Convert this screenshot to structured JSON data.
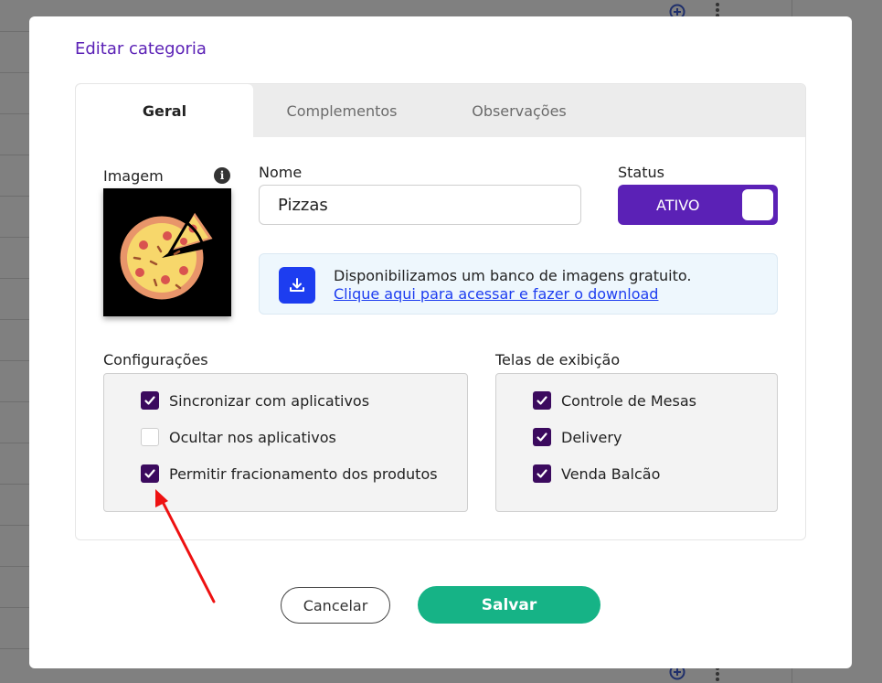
{
  "modal": {
    "title": "Editar categoria"
  },
  "tabs": [
    {
      "label": "Geral",
      "active": true
    },
    {
      "label": "Complementos",
      "active": false
    },
    {
      "label": "Observações",
      "active": false
    }
  ],
  "image": {
    "label": "Imagem",
    "info_icon": "info-icon",
    "picture": "pizza-icon"
  },
  "name": {
    "label": "Nome",
    "value": "Pizzas"
  },
  "status": {
    "label": "Status",
    "value": "ATIVO",
    "on": true
  },
  "banner": {
    "text": "Disponibilizamos um banco de imagens gratuito.",
    "link": "Clique aqui para acessar e fazer o download",
    "icon": "download-icon"
  },
  "configuracoes": {
    "label": "Configurações",
    "items": [
      {
        "label": "Sincronizar com aplicativos",
        "checked": true
      },
      {
        "label": "Ocultar nos aplicativos",
        "checked": false
      },
      {
        "label": "Permitir fracionamento dos produtos",
        "checked": true
      }
    ]
  },
  "telas": {
    "label": "Telas de exibição",
    "items": [
      {
        "label": "Controle de Mesas",
        "checked": true
      },
      {
        "label": "Delivery",
        "checked": true
      },
      {
        "label": "Venda Balcão",
        "checked": true
      }
    ]
  },
  "actions": {
    "cancel": "Cancelar",
    "save": "Salvar"
  },
  "colors": {
    "accent": "#5b21b6",
    "checkbox": "#3b0a5e",
    "save": "#16b386",
    "link": "#1d3df0",
    "annotation_arrow": "#ee1111"
  }
}
